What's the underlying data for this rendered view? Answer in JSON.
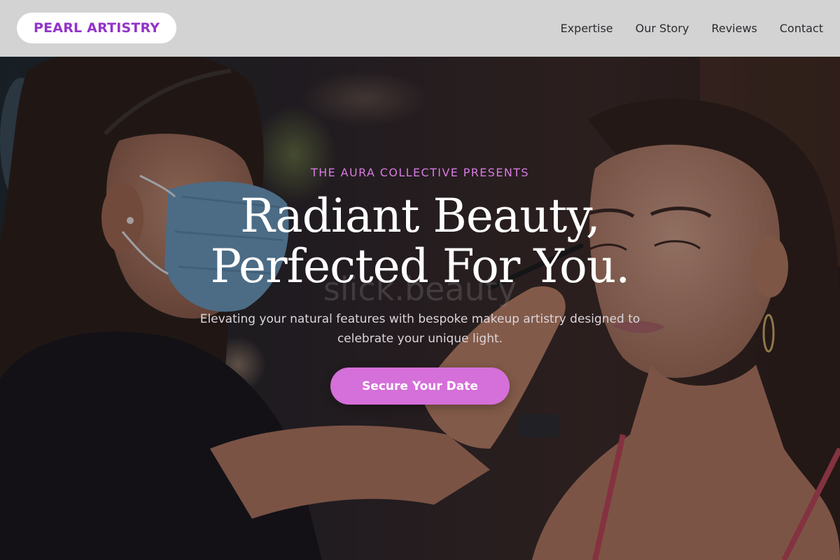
{
  "header": {
    "logo": "PEARL ARTISTRY",
    "nav": [
      {
        "label": "Expertise"
      },
      {
        "label": "Our Story"
      },
      {
        "label": "Reviews"
      },
      {
        "label": "Contact"
      }
    ]
  },
  "hero": {
    "eyebrow": "THE AURA COLLECTIVE PRESENTS",
    "headline_line1": "Radiant Beauty,",
    "headline_line2": "Perfected For You.",
    "subtext": "Elevating your natural features with bespoke makeup artistry designed to celebrate your unique light.",
    "cta_label": "Secure Your Date",
    "watermark": "slick.beauty"
  },
  "colors": {
    "accent": "#d56fd9",
    "logo": "#9333c9",
    "eyebrow": "#d77be0",
    "header_bg": "#d3d3d3"
  }
}
